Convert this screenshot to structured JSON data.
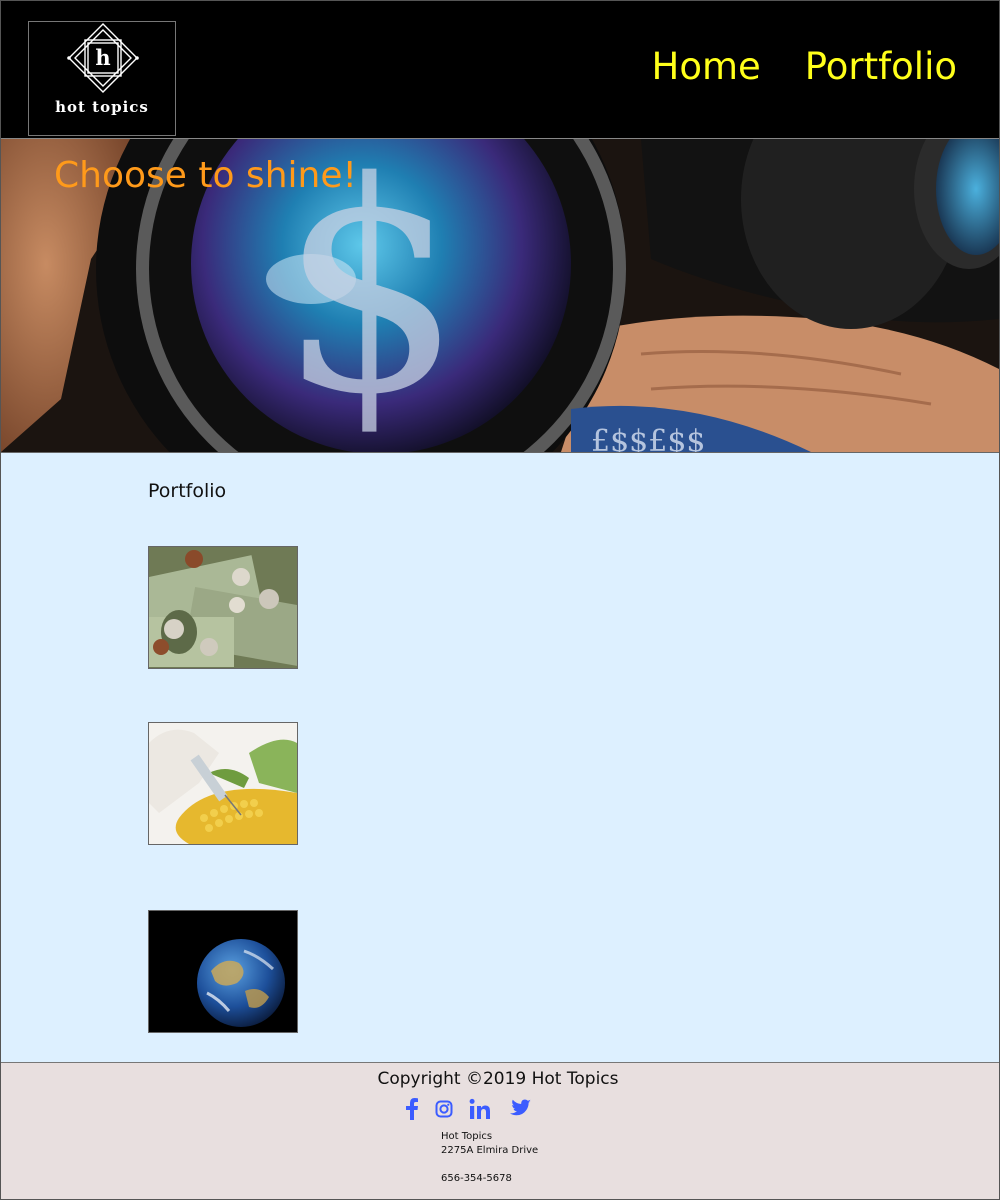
{
  "logo": {
    "letter": "h",
    "text": "hot topics"
  },
  "nav": {
    "home": "Home",
    "portfolio": "Portfolio"
  },
  "hero": {
    "title": "Choose to shine!"
  },
  "main": {
    "section_title": "Portfolio"
  },
  "footer": {
    "copyright": "Copyright ©2019 Hot Topics",
    "company": "Hot Topics",
    "street": "2275A Elmira Drive",
    "phone": "656-354-5678",
    "social_icons": [
      "facebook-icon",
      "instagram-icon",
      "linkedin-icon",
      "twitter-icon"
    ]
  },
  "colors": {
    "header_bg": "#000000",
    "nav_text": "#ffff1a",
    "hero_title": "#ff9a1a",
    "main_bg": "#ddf0ff",
    "footer_bg": "#e8dfdf",
    "social": "#3b5cff"
  }
}
